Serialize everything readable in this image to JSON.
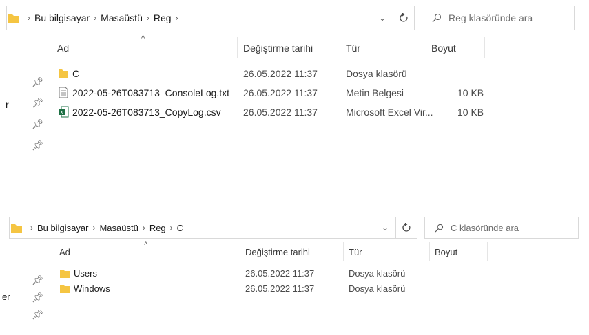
{
  "pane1": {
    "breadcrumb": [
      "Bu bilgisayar",
      "Masaüstü",
      "Reg"
    ],
    "search_placeholder": "Reg klasöründe ara",
    "columns": {
      "name": "Ad",
      "date": "Değiştirme tarihi",
      "type": "Tür",
      "size": "Boyut"
    },
    "nav_edge_letter": "r",
    "rows": [
      {
        "name": "C",
        "date": "26.05.2022 11:37",
        "type": "Dosya klasörü",
        "size": "",
        "icon": "folder-icon"
      },
      {
        "name": "2022-05-26T083713_ConsoleLog.txt",
        "date": "26.05.2022 11:37",
        "type": "Metin Belgesi",
        "size": "10 KB",
        "icon": "text-file-icon"
      },
      {
        "name": "2022-05-26T083713_CopyLog.csv",
        "date": "26.05.2022 11:37",
        "type": "Microsoft Excel Vir...",
        "size": "10 KB",
        "icon": "excel-file-icon"
      }
    ]
  },
  "pane2": {
    "breadcrumb": [
      "Bu bilgisayar",
      "Masaüstü",
      "Reg",
      "C"
    ],
    "search_placeholder": "C klasöründe ara",
    "columns": {
      "name": "Ad",
      "date": "Değiştirme tarihi",
      "type": "Tür",
      "size": "Boyut"
    },
    "nav_edge_letter": "er",
    "rows": [
      {
        "name": "Users",
        "date": "26.05.2022 11:37",
        "type": "Dosya klasörü",
        "size": "",
        "icon": "folder-icon"
      },
      {
        "name": "Windows",
        "date": "26.05.2022 11:37",
        "type": "Dosya klasörü",
        "size": "",
        "icon": "folder-icon"
      }
    ]
  },
  "colors": {
    "folder": "#f5c542",
    "excel": "#1d7044",
    "border": "#d9d9d9"
  }
}
